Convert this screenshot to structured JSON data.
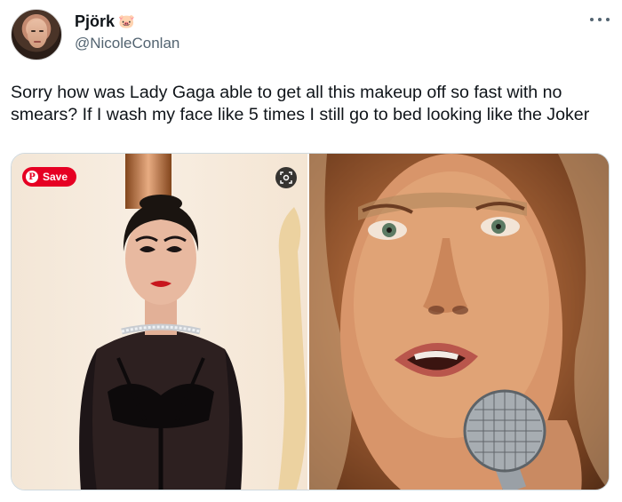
{
  "author": {
    "display_name": "Pjörk",
    "name_emoji": "🐷",
    "handle": "@NicoleConlan"
  },
  "tweet": {
    "text": "Sorry how was Lady Gaga able to get all this makeup off so fast with no smears? If I wash my face like 5 times I still go to bed looking like the Joker"
  },
  "media": {
    "save_label": "Save",
    "pin_glyph": "P",
    "left_photo": "photo-red-carpet-makeup",
    "right_photo": "photo-singing-no-makeup"
  },
  "colors": {
    "save_red": "#e60023",
    "handle_gray": "#536471",
    "text": "#0f1419"
  },
  "icons": [
    "more-icon",
    "pinterest-icon",
    "visual-search-icon",
    "pig-icon"
  ]
}
